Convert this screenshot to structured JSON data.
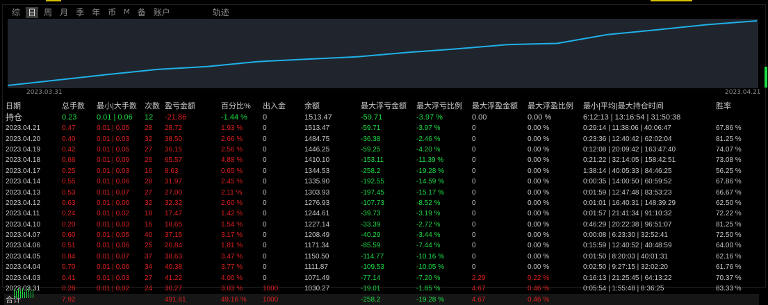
{
  "tabs": [
    {
      "label": "综",
      "active": false
    },
    {
      "label": "日",
      "active": true
    },
    {
      "label": "周",
      "active": false
    },
    {
      "label": "月",
      "active": false
    },
    {
      "label": "季",
      "active": false
    },
    {
      "label": "年",
      "active": false
    },
    {
      "label": "币",
      "active": false
    },
    {
      "label": "M",
      "active": false
    },
    {
      "label": "备",
      "active": false
    },
    {
      "label": "账户",
      "active": false
    },
    {
      "label": "轨迹",
      "active": false
    }
  ],
  "chart": {
    "line_color": "#1fb0e8",
    "start_label": "2023.03.31",
    "end_label": "2023.04.21",
    "equity": [
      1030.27,
      1071.49,
      1111.87,
      1150.5,
      1171.34,
      1208.49,
      1227.14,
      1244.61,
      1276.93,
      1303.93,
      1335.9,
      1344.53,
      1410.1,
      1446.25,
      1484.75,
      1513.47
    ]
  },
  "columns": [
    "日期",
    "总手数",
    "最小|大手数",
    "次数",
    "盈亏金额",
    "百分比%",
    "出入金",
    "余额",
    "最大浮亏金额",
    "最大浮亏比例",
    "最大浮盈金额",
    "最大浮盈比例",
    "最小|平均|最大持仓时间",
    "胜率"
  ],
  "holding": {
    "date": "持仓",
    "lots": "0.23",
    "minmax": "0.01 | 0.06",
    "count": "12",
    "pnl": "-21.86",
    "pct": "-1.44 %",
    "flow": "0",
    "balance": "1513.47",
    "mdd": "-59.71",
    "mddp": "-3.97 %",
    "mfe": "0.00",
    "mfep": "0.00 %",
    "time": "6:12:13 | 13:16:54 | 31:50:38",
    "win": ""
  },
  "rows": [
    {
      "date": "2023.04.21",
      "lots": "0.47",
      "minmax": "0.01 | 0.05",
      "count": "28",
      "pnl": "28.72",
      "pct": "1.93 %",
      "flow": "0",
      "balance": "1513.47",
      "mdd": "-59.71",
      "mddp": "-3.97 %",
      "mfe": "0",
      "mfep": "0.00 %",
      "time": "0:29:14 | 11:38:06 | 40:06:47",
      "win": "67.86 %"
    },
    {
      "date": "2023.04.20",
      "lots": "0.40",
      "minmax": "0.01 | 0.03",
      "count": "32",
      "pnl": "38.50",
      "pct": "2.66 %",
      "flow": "0",
      "balance": "1484.75",
      "mdd": "-36.38",
      "mddp": "-2.46 %",
      "mfe": "0",
      "mfep": "0.00 %",
      "time": "0:23:36 | 12:40:42 | 62:02:04",
      "win": "81.25 %"
    },
    {
      "date": "2023.04.19",
      "lots": "0.42",
      "minmax": "0.01 | 0.05",
      "count": "27",
      "pnl": "36.15",
      "pct": "2.56 %",
      "flow": "0",
      "balance": "1446.25",
      "mdd": "-59.25",
      "mddp": "-4.20 %",
      "mfe": "0",
      "mfep": "0.00 %",
      "time": "0:12:08 | 20:09:42 | 163:47:40",
      "win": "74.07 %"
    },
    {
      "date": "2023.04.18",
      "lots": "0.66",
      "minmax": "0.01 | 0.09",
      "count": "26",
      "pnl": "65.57",
      "pct": "4.88 %",
      "flow": "0",
      "balance": "1410.10",
      "mdd": "-153.11",
      "mddp": "-11.39 %",
      "mfe": "0",
      "mfep": "0.00 %",
      "time": "0:21:22 | 32:14:05 | 158:42:51",
      "win": "73.08 %"
    },
    {
      "date": "2023.04.17",
      "lots": "0.25",
      "minmax": "0.01 | 0.03",
      "count": "16",
      "pnl": "8.63",
      "pct": "0.65 %",
      "flow": "0",
      "balance": "1344.53",
      "mdd": "-258.2",
      "mddp": "-19.28 %",
      "mfe": "0",
      "mfep": "0.00 %",
      "time": "1:38:14 | 40:05:33 | 84:46:25",
      "win": "56.25 %"
    },
    {
      "date": "2023.04.14",
      "lots": "0.55",
      "minmax": "0.01 | 0.06",
      "count": "28",
      "pnl": "31.97",
      "pct": "2.45 %",
      "flow": "0",
      "balance": "1335.90",
      "mdd": "-192.55",
      "mddp": "-14.59 %",
      "mfe": "0",
      "mfep": "0.00 %",
      "time": "0:00:35 | 14:00:50 | 60:59:52",
      "win": "67.86 %"
    },
    {
      "date": "2023.04.13",
      "lots": "0.53",
      "minmax": "0.01 | 0.07",
      "count": "27",
      "pnl": "27.00",
      "pct": "2.11 %",
      "flow": "0",
      "balance": "1303.93",
      "mdd": "-197.45",
      "mddp": "-15.17 %",
      "mfe": "0",
      "mfep": "0.00 %",
      "time": "0:01:59 | 12:47:48 | 83:53:23",
      "win": "66.67 %"
    },
    {
      "date": "2023.04.12",
      "lots": "0.63",
      "minmax": "0.01 | 0.06",
      "count": "32",
      "pnl": "32.32",
      "pct": "2.60 %",
      "flow": "0",
      "balance": "1276.93",
      "mdd": "-107.73",
      "mddp": "-8.52 %",
      "mfe": "0",
      "mfep": "0.00 %",
      "time": "0:01:01 | 16:40:31 | 148:39:29",
      "win": "62.50 %"
    },
    {
      "date": "2023.04.11",
      "lots": "0.24",
      "minmax": "0.01 | 0.02",
      "count": "18",
      "pnl": "17.47",
      "pct": "1.42 %",
      "flow": "0",
      "balance": "1244.61",
      "mdd": "-39.73",
      "mddp": "-3.19 %",
      "mfe": "0",
      "mfep": "0.00 %",
      "time": "0:01:57 | 21:41:34 | 91:10:32",
      "win": "72.22 %"
    },
    {
      "date": "2023.04.10",
      "lots": "0.20",
      "minmax": "0.01 | 0.03",
      "count": "16",
      "pnl": "18.65",
      "pct": "1.54 %",
      "flow": "0",
      "balance": "1227.14",
      "mdd": "-33.39",
      "mddp": "-2.72 %",
      "mfe": "0",
      "mfep": "0.00 %",
      "time": "0:46:29 | 20:22:38 | 96:51:07",
      "win": "81.25 %"
    },
    {
      "date": "2023.04.07",
      "lots": "0.60",
      "minmax": "0.01 | 0.05",
      "count": "40",
      "pnl": "37.15",
      "pct": "3.17 %",
      "flow": "0",
      "balance": "1208.49",
      "mdd": "-40.29",
      "mddp": "-3.44 %",
      "mfe": "0",
      "mfep": "0.00 %",
      "time": "0:00:08 | 6:23:30 | 32:52:41",
      "win": "72.50 %"
    },
    {
      "date": "2023.04.06",
      "lots": "0.51",
      "minmax": "0.01 | 0.06",
      "count": "25",
      "pnl": "20.84",
      "pct": "1.81 %",
      "flow": "0",
      "balance": "1171.34",
      "mdd": "-85.59",
      "mddp": "-7.44 %",
      "mfe": "0",
      "mfep": "0.00 %",
      "time": "0:15:59 | 12:40:52 | 40:48:59",
      "win": "64.00 %"
    },
    {
      "date": "2023.04.05",
      "lots": "0.84",
      "minmax": "0.01 | 0.07",
      "count": "37",
      "pnl": "38.63",
      "pct": "3.47 %",
      "flow": "0",
      "balance": "1150.50",
      "mdd": "-114.77",
      "mddp": "-10.16 %",
      "mfe": "0",
      "mfep": "0.00 %",
      "time": "0:01:50 | 8:20:03 | 40:01:31",
      "win": "62.16 %"
    },
    {
      "date": "2023.04.04",
      "lots": "0.70",
      "minmax": "0.01 | 0.06",
      "count": "34",
      "pnl": "40.38",
      "pct": "3.77 %",
      "flow": "0",
      "balance": "1111.87",
      "mdd": "-109.53",
      "mddp": "-10.05 %",
      "mfe": "0",
      "mfep": "0.00 %",
      "time": "0:02:50 | 9:27:15 | 32:02:20",
      "win": "61.76 %"
    },
    {
      "date": "2023.04.03",
      "lots": "0.41",
      "minmax": "0.01 | 0.03",
      "count": "27",
      "pnl": "41.22",
      "pct": "4.00 %",
      "flow": "0",
      "balance": "1071.49",
      "mdd": "-77.14",
      "mddp": "-7.20 %",
      "mfe": "2.29",
      "mfep": "0.22 %",
      "time": "0:16:13 | 21:25:45 | 64:13:22",
      "win": "70.37 %"
    },
    {
      "date": "2023.03.31",
      "lots": "0.28",
      "minmax": "0.01 | 0.02",
      "count": "24",
      "pnl": "30.27",
      "pct": "3.03 %",
      "flow": "1000",
      "balance": "1030.27",
      "mdd": "-19.01",
      "mddp": "-1.85 %",
      "mfe": "4.67",
      "mfep": "0.46 %",
      "time": "0:05:54 | 1:55:48 | 8:36:25",
      "win": "83.33 %"
    }
  ],
  "total": {
    "date": "合计",
    "lots": "7.92",
    "minmax": "",
    "count": "",
    "pnl": "491.61",
    "pct": "49.16 %",
    "flow": "1000",
    "balance": "",
    "mdd": "-258.2",
    "mddp": "-19.28 %",
    "mfe": "4.67",
    "mfep": "0.46 %",
    "time": "",
    "win": ""
  }
}
